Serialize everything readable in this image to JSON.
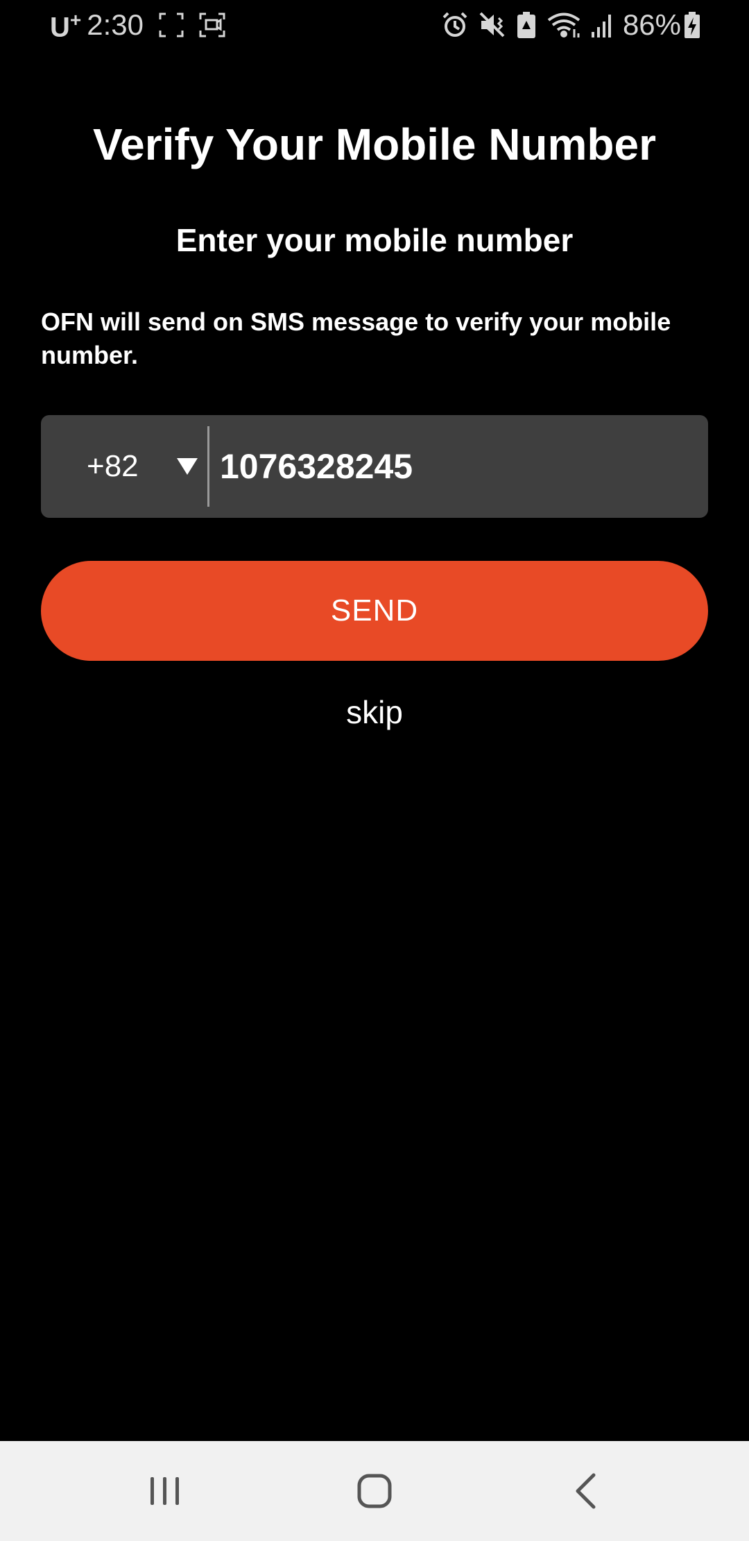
{
  "status_bar": {
    "carrier": "U",
    "carrier_sup": "+",
    "time": "2:30",
    "battery_percent": "86%",
    "icons_left": [
      "screen-expand-icon",
      "screenshot-icon"
    ],
    "icons_right": [
      "alarm-icon",
      "mute-vibrate-icon",
      "battery-saver-icon",
      "wifi-icon",
      "signal-icon",
      "battery-charging-icon"
    ]
  },
  "header": {
    "title": "Verify Your Mobile Number",
    "subtitle": "Enter your mobile number"
  },
  "description": "OFN will send on SMS message to verify your mobile number.",
  "phone": {
    "country_code": "+82",
    "number": "1076328245"
  },
  "actions": {
    "send_label": "SEND",
    "skip_label": "skip"
  },
  "colors": {
    "background": "#000000",
    "accent": "#e84a26",
    "input_background": "#3f3f3f",
    "nav_background": "#f1f1f1"
  },
  "nav_bar": {
    "buttons": [
      "recents-icon",
      "home-icon",
      "back-icon"
    ]
  }
}
